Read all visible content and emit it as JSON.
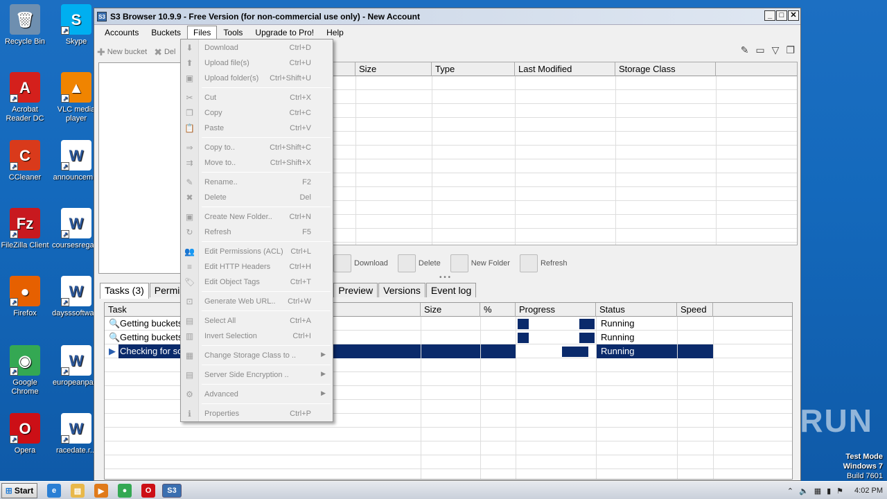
{
  "desktop": {
    "icons": [
      {
        "label": "Recycle Bin",
        "icon": "recycle-bin-icon",
        "color": "#6e8fb0"
      },
      {
        "label": "Skype",
        "icon": "skype-icon",
        "color": "#00aff0"
      },
      {
        "label": "Acrobat Reader DC",
        "icon": "acrobat-icon",
        "color": "#d4201c"
      },
      {
        "label": "VLC media player",
        "icon": "vlc-icon",
        "color": "#f08400"
      },
      {
        "label": "CCleaner",
        "icon": "ccleaner-icon",
        "color": "#d93a1b"
      },
      {
        "label": "announcem...",
        "icon": "word-doc-icon",
        "color": "#ffffff"
      },
      {
        "label": "FileZilla Client",
        "icon": "filezilla-icon",
        "color": "#c8191f"
      },
      {
        "label": "coursesrega...",
        "icon": "word-doc-icon",
        "color": "#ffffff"
      },
      {
        "label": "Firefox",
        "icon": "firefox-icon",
        "color": "#e66000"
      },
      {
        "label": "daysssoftwa...",
        "icon": "word-doc-icon",
        "color": "#ffffff"
      },
      {
        "label": "Google Chrome",
        "icon": "chrome-icon",
        "color": "#34a853"
      },
      {
        "label": "europeanpa...",
        "icon": "word-doc-icon",
        "color": "#ffffff"
      },
      {
        "label": "Opera",
        "icon": "opera-icon",
        "color": "#cc0f16"
      },
      {
        "label": "racedate.r...",
        "icon": "word-doc-icon",
        "color": "#ffffff"
      }
    ],
    "watermark": "ANY RUN",
    "test_mode": {
      "line1": "Test Mode",
      "line2": "Windows 7",
      "line3": "Build 7601"
    }
  },
  "window": {
    "title": "S3 Browser 10.9.9 - Free Version (for non-commercial use only) - New Account",
    "app_icon": "S3",
    "menus": [
      "Accounts",
      "Buckets",
      "Files",
      "Tools",
      "Upgrade to Pro!",
      "Help"
    ],
    "open_menu": "Files",
    "toolbar": {
      "new_bucket": "New bucket",
      "delete": "Del"
    },
    "file_columns": [
      "Size",
      "Type",
      "Last Modified",
      "Storage Class"
    ],
    "file_buttons": [
      "Download",
      "Delete",
      "New Folder",
      "Refresh"
    ],
    "tabs": [
      "Tasks (3)",
      "Permis",
      "Preview",
      "Versions",
      "Event log"
    ],
    "task_columns": [
      "Task",
      "Size",
      "%",
      "Progress",
      "Status",
      "Speed"
    ],
    "tasks": [
      {
        "task": "Getting buckets",
        "status": "Running",
        "selected": false
      },
      {
        "task": "Getting buckets",
        "status": "Running",
        "selected": false
      },
      {
        "task": "Checking for so",
        "status": "Running",
        "selected": true
      }
    ]
  },
  "files_menu": {
    "groups": [
      [
        {
          "label": "Download",
          "shortcut": "Ctrl+D",
          "icon": "download-icon"
        },
        {
          "label": "Upload file(s)",
          "shortcut": "Ctrl+U",
          "icon": "upload-icon"
        },
        {
          "label": "Upload folder(s)",
          "shortcut": "Ctrl+Shift+U",
          "icon": "upload-folder-icon"
        }
      ],
      [
        {
          "label": "Cut",
          "shortcut": "Ctrl+X",
          "icon": "cut-icon"
        },
        {
          "label": "Copy",
          "shortcut": "Ctrl+C",
          "icon": "copy-icon"
        },
        {
          "label": "Paste",
          "shortcut": "Ctrl+V",
          "icon": "paste-icon"
        }
      ],
      [
        {
          "label": "Copy to..",
          "shortcut": "Ctrl+Shift+C",
          "icon": "copy-to-icon"
        },
        {
          "label": "Move to..",
          "shortcut": "Ctrl+Shift+X",
          "icon": "move-to-icon"
        }
      ],
      [
        {
          "label": "Rename..",
          "shortcut": "F2",
          "icon": "pencil-icon"
        },
        {
          "label": "Delete",
          "shortcut": "Del",
          "icon": "delete-icon"
        }
      ],
      [
        {
          "label": "Create New Folder..",
          "shortcut": "Ctrl+N",
          "icon": "new-folder-icon"
        },
        {
          "label": "Refresh",
          "shortcut": "F5",
          "icon": "refresh-icon"
        }
      ],
      [
        {
          "label": "Edit Permissions (ACL)",
          "shortcut": "Ctrl+L",
          "icon": "permissions-icon"
        },
        {
          "label": "Edit HTTP Headers",
          "shortcut": "Ctrl+H",
          "icon": "headers-icon"
        },
        {
          "label": "Edit Object Tags",
          "shortcut": "Ctrl+T",
          "icon": "tag-icon"
        }
      ],
      [
        {
          "label": "Generate Web URL..",
          "shortcut": "Ctrl+W",
          "icon": "web-url-icon"
        }
      ],
      [
        {
          "label": "Select All",
          "shortcut": "Ctrl+A",
          "icon": "select-all-icon"
        },
        {
          "label": "Invert Selection",
          "shortcut": "Ctrl+I",
          "icon": "invert-selection-icon"
        }
      ],
      [
        {
          "label": "Change Storage Class to ..",
          "shortcut": "",
          "icon": "storage-class-icon",
          "submenu": true
        }
      ],
      [
        {
          "label": "Server Side Encryption ..",
          "shortcut": "",
          "icon": "encryption-icon",
          "submenu": true
        }
      ],
      [
        {
          "label": "Advanced",
          "shortcut": "",
          "icon": "advanced-icon",
          "submenu": true
        }
      ],
      [
        {
          "label": "Properties",
          "shortcut": "Ctrl+P",
          "icon": "info-icon"
        }
      ]
    ]
  },
  "taskbar": {
    "start": "Start",
    "apps": [
      {
        "name": "ie-icon",
        "color": "#2a7fd4",
        "glyph": "e"
      },
      {
        "name": "explorer-icon",
        "color": "#e8b84a",
        "glyph": "▤"
      },
      {
        "name": "media-player-icon",
        "color": "#e07a1a",
        "glyph": "▶"
      },
      {
        "name": "chrome-icon",
        "color": "#34a853",
        "glyph": "●"
      },
      {
        "name": "opera-icon",
        "color": "#cc0f16",
        "glyph": "O"
      },
      {
        "name": "s3-browser-icon",
        "color": "#3a6fb0",
        "glyph": "S3"
      }
    ],
    "clock": "4:02 PM"
  },
  "colors": {
    "selection": "#0a2a6b",
    "desktop": "#1465b4",
    "progress": "#0a2a6b"
  }
}
